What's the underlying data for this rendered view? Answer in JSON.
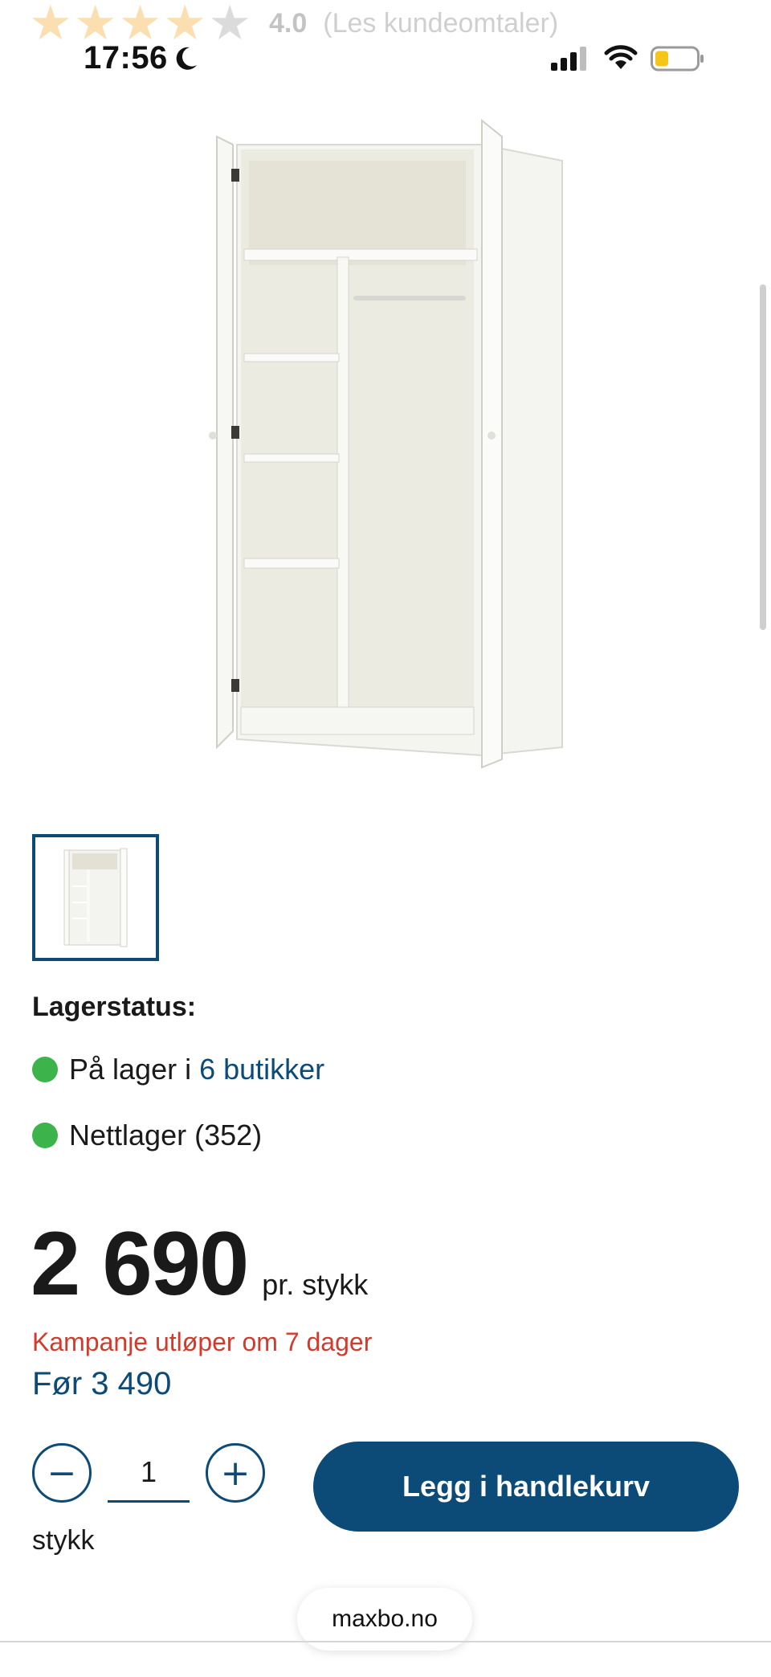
{
  "rating": {
    "stars_filled": 4,
    "stars_total": 5,
    "score": "4.0",
    "reviews_link": "(Les  kundeomtaler)"
  },
  "status_bar": {
    "time": "17:56",
    "icons": [
      "moon-icon",
      "signal-icon",
      "wifi-icon",
      "battery-icon"
    ]
  },
  "product": {
    "image": "wardrobe-image",
    "thumbnail": "wardrobe-thumbnail"
  },
  "stock": {
    "title": "Lagerstatus:",
    "in_store_text": "På lager i",
    "in_store_link": "6 butikker",
    "online_text": "Nettlager (352)",
    "status_color": "#3cb44b"
  },
  "price": {
    "amount": "2 690",
    "unit": "pr. stykk",
    "campaign": "Kampanje utløper om 7 dager",
    "before": "Før 3 490"
  },
  "quantity": {
    "minus_label": "−",
    "value": "1",
    "plus_label": "+",
    "unit": "stykk"
  },
  "cart": {
    "button_label": "Legg i handlekurv"
  },
  "browser": {
    "url": "maxbo.no"
  },
  "colors": {
    "brand": "#0c4a78",
    "campaign": "#d23a2b",
    "in_stock": "#3cb44b"
  }
}
